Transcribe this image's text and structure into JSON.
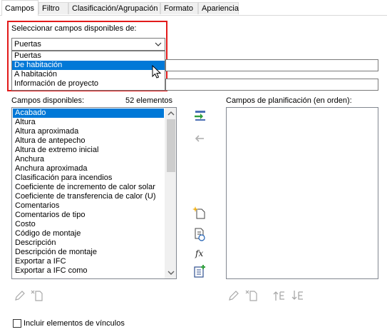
{
  "tabs": [
    {
      "label": "Campos"
    },
    {
      "label": "Filtro"
    },
    {
      "label": "Clasificación/Agrupación"
    },
    {
      "label": "Formato"
    },
    {
      "label": "Apariencia"
    }
  ],
  "field_source": {
    "label": "Seleccionar campos disponibles de:",
    "selected": "Puertas",
    "options": [
      "Puertas",
      "De habitación",
      "A habitación",
      "Información de proyecto"
    ],
    "hovered_option": "De habitación"
  },
  "available": {
    "label": "Campos disponibles:",
    "count": "52 elementos",
    "items": [
      "Acabado",
      "Altura",
      "Altura aproximada",
      "Altura de antepecho",
      "Altura de extremo inicial",
      "Anchura",
      "Anchura aproximada",
      "Clasificación para incendios",
      "Coeficiente de incremento de calor solar",
      "Coeficiente de transferencia de calor (U)",
      "Comentarios",
      "Comentarios de tipo",
      "Costo",
      "Código de montaje",
      "Descripción",
      "Descripción de montaje",
      "Exportar a IFC",
      "Exportar a IFC como"
    ],
    "selected_item": "Acabado"
  },
  "scheduled": {
    "label": "Campos de planificación (en orden):"
  },
  "include_links": {
    "label": "Incluir elementos de vínculos",
    "checked": false
  }
}
